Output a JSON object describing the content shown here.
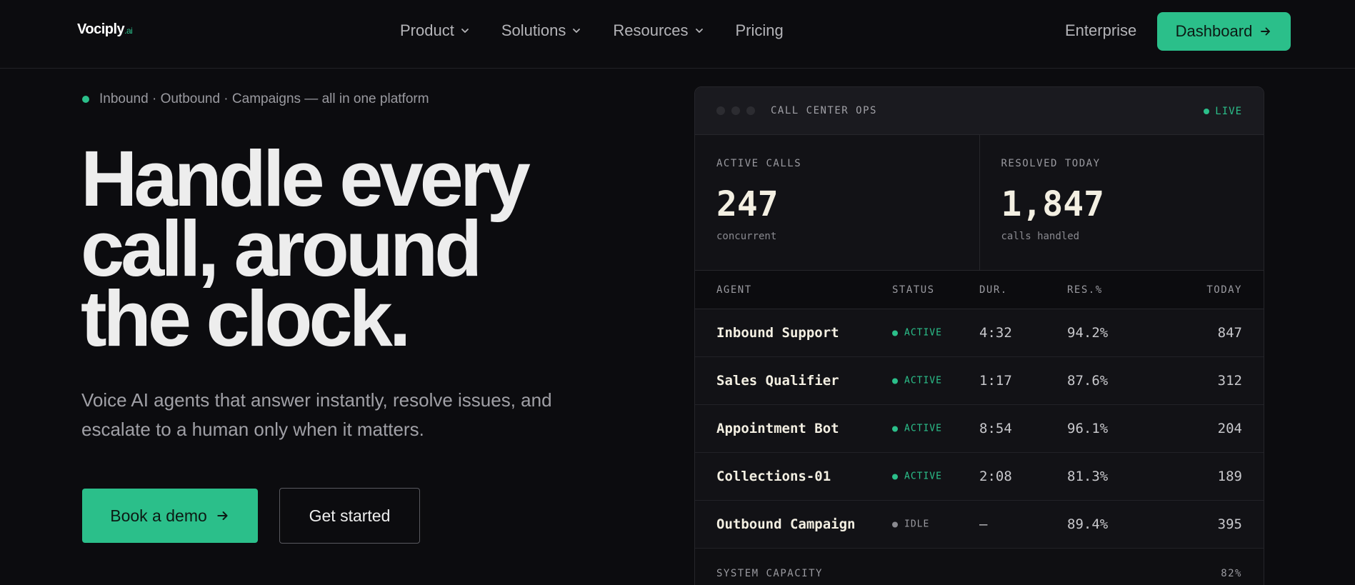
{
  "nav": {
    "logo_main": "Vociply",
    "logo_suffix": ".ai",
    "links": [
      {
        "label": "Product",
        "has_dropdown": true
      },
      {
        "label": "Solutions",
        "has_dropdown": true
      },
      {
        "label": "Resources",
        "has_dropdown": true
      },
      {
        "label": "Pricing",
        "has_dropdown": false
      }
    ],
    "enterprise_label": "Enterprise",
    "dashboard_label": "Dashboard"
  },
  "hero": {
    "eyebrow": "Inbound · Outbound · Campaigns — all in one platform",
    "headline": "Handle every call, around the clock.",
    "subcopy": "Voice AI agents that answer instantly, resolve issues, and escalate to a human only when it matters.",
    "primary_cta": "Book a demo",
    "secondary_cta": "Get started"
  },
  "panel": {
    "title": "CALL CENTER OPS",
    "live_label": "LIVE",
    "stats": [
      {
        "label": "ACTIVE CALLS",
        "value": "247",
        "sub": "concurrent"
      },
      {
        "label": "RESOLVED TODAY",
        "value": "1,847",
        "sub": "calls handled"
      }
    ],
    "columns": {
      "agent": "AGENT",
      "status": "STATUS",
      "duration": "DUR.",
      "resolution": "RES.%",
      "today": "TODAY"
    },
    "rows": [
      {
        "agent": "Inbound Support",
        "status": "ACTIVE",
        "duration": "4:32",
        "resolution": "94.2%",
        "today": "847"
      },
      {
        "agent": "Sales Qualifier",
        "status": "ACTIVE",
        "duration": "1:17",
        "resolution": "87.6%",
        "today": "312"
      },
      {
        "agent": "Appointment Bot",
        "status": "ACTIVE",
        "duration": "8:54",
        "resolution": "96.1%",
        "today": "204"
      },
      {
        "agent": "Collections-01",
        "status": "ACTIVE",
        "duration": "2:08",
        "resolution": "81.3%",
        "today": "189"
      },
      {
        "agent": "Outbound Campaign",
        "status": "IDLE",
        "duration": "—",
        "resolution": "89.4%",
        "today": "395"
      }
    ],
    "capacity_label": "SYSTEM CAPACITY",
    "capacity_value": "82%"
  },
  "colors": {
    "accent": "#2bbf8a",
    "background": "#0c0c0f",
    "idle": "#8a8a90"
  },
  "icons": {
    "dropdown": "chevron-down-icon",
    "cta_arrow": "arrow-right-icon"
  }
}
